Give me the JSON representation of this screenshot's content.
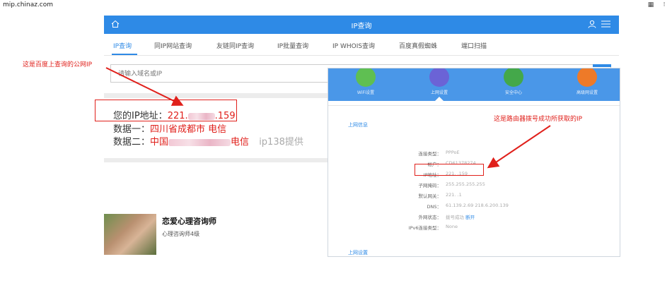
{
  "browser": {
    "url": "mip.chinaz.com"
  },
  "header": {
    "title": "IP查询"
  },
  "tabs": [
    {
      "label": "IP查询"
    },
    {
      "label": "同IP网站查询"
    },
    {
      "label": "友链同IP查询"
    },
    {
      "label": "IP批量查询"
    },
    {
      "label": "IP WHOIS查询"
    },
    {
      "label": "百度真假蜘蛛"
    },
    {
      "label": "端口扫描"
    }
  ],
  "search": {
    "placeholder": "请输入域名或IP"
  },
  "result": {
    "ip_label": "您的IP地址：",
    "ip_prefix": "221.",
    "ip_suffix": ".159",
    "data1_label": "数据一：",
    "data1_value": "四川省成都市 电信",
    "data2_label": "数据二：",
    "data2_prefix": "中国",
    "data2_suffix": "电信",
    "data2_note": "ip138提供"
  },
  "profile": {
    "name": "恋爱心理咨询师",
    "subtitle": "心理咨询师4级"
  },
  "router": {
    "nav": [
      {
        "label": "WiFi设置",
        "color": "#5fbf52"
      },
      {
        "label": "上网设置",
        "color": "#6b63d6"
      },
      {
        "label": "安全中心",
        "color": "#44a84a"
      },
      {
        "label": "高级网设置",
        "color": "#ee7a28"
      }
    ],
    "section_title": "上网信息",
    "rows": [
      {
        "key": "连接类型：",
        "value": "PPPoE"
      },
      {
        "key": "帐户：",
        "value": "CD61378274"
      },
      {
        "key": "IP地址：",
        "value": "221.    .159"
      },
      {
        "key": "子网掩码：",
        "value": "255.255.255.255"
      },
      {
        "key": "默认网关：",
        "value": "221.    .1"
      },
      {
        "key": "DNS：",
        "value": "61.139.2.69 218.6.200.139"
      },
      {
        "key": "外网状态：",
        "value": "拨号成功",
        "link": "断开"
      },
      {
        "key": "IPv6连接类型：",
        "value": "None"
      }
    ],
    "section2_title": "上网设置"
  },
  "annotations": {
    "left": "这是百度上查询的公网IP",
    "right": "这是路由器拨号成功所获取的IP"
  },
  "colors": {
    "accent": "#2e8ae6",
    "annotation": "#e0201b"
  }
}
